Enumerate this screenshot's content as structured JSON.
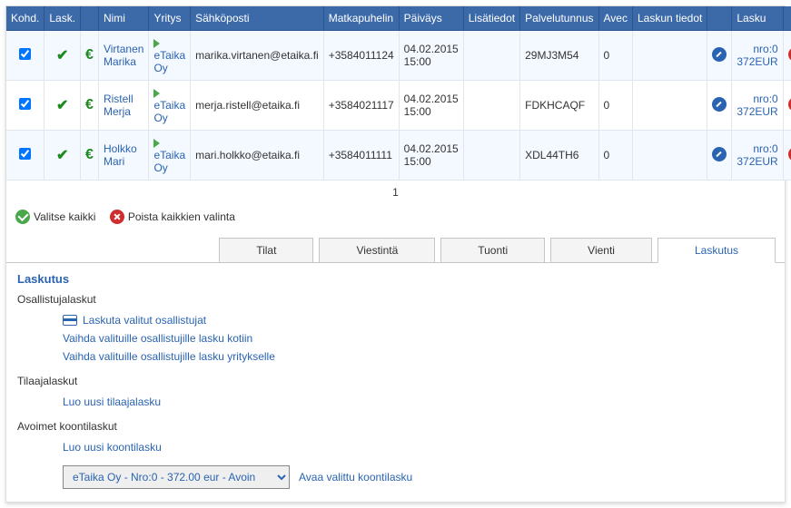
{
  "headers": {
    "kohd": "Kohd.",
    "lask": "Lask.",
    "nimi": "Nimi",
    "yritys": "Yritys",
    "sahkoposti": "Sähköposti",
    "matkapuhelin": "Matkapuhelin",
    "paivays": "Päiväys",
    "lisatiedot": "Lisätiedot",
    "palvelutunnus": "Palvelutunnus",
    "avec": "Avec",
    "laskun_tiedot": "Laskun tiedot",
    "lasku": "Lasku"
  },
  "rows": [
    {
      "nimi": "Virtanen Marika",
      "yritys": "eTaika Oy",
      "sahkoposti": "marika.virtanen@etaika.fi",
      "matkapuhelin": "+3584011124",
      "paivays": "04.02.2015 15:00",
      "lisatiedot": "",
      "palvelutunnus": "29MJ3M54",
      "avec": "0",
      "laskun_tiedot": "",
      "lasku_nro": "nro:0",
      "lasku_sum": "372EUR"
    },
    {
      "nimi": "Ristell Merja",
      "yritys": "eTaika Oy",
      "sahkoposti": "merja.ristell@etaika.fi",
      "matkapuhelin": "+3584021117",
      "paivays": "04.02.2015 15:00",
      "lisatiedot": "",
      "palvelutunnus": "FDKHCAQF",
      "avec": "0",
      "laskun_tiedot": "",
      "lasku_nro": "nro:0",
      "lasku_sum": "372EUR"
    },
    {
      "nimi": "Holkko Mari",
      "yritys": "eTaika Oy",
      "sahkoposti": "mari.holkko@etaika.fi",
      "matkapuhelin": "+3584011111",
      "paivays": "04.02.2015 15:00",
      "lisatiedot": "",
      "palvelutunnus": "XDL44TH6",
      "avec": "0",
      "laskun_tiedot": "",
      "lasku_nro": "nro:0",
      "lasku_sum": "372EUR"
    }
  ],
  "pager": {
    "page": "1"
  },
  "selection": {
    "select_all": "Valitse kaikki",
    "deselect_all": "Poista kaikkien valinta"
  },
  "tabs": {
    "tilat": "Tilat",
    "viestinta": "Viestintä",
    "tuonti": "Tuonti",
    "vienti": "Vienti",
    "laskutus": "Laskutus"
  },
  "invoicing": {
    "title": "Laskutus",
    "osallistujalaskut": "Osallistujalaskut",
    "laskuta_valitut": "Laskuta valitut osallistujat",
    "vaihda_kotiin": "Vaihda valituille osallistujille lasku kotiin",
    "vaihda_yritykselle": "Vaihda valituille osallistujille lasku yritykselle",
    "tilaajalaskut": "Tilaajalaskut",
    "luo_tilaajalasku": "Luo uusi tilaajalasku",
    "avoimet_koontilaskut": "Avoimet koontilaskut",
    "luo_koontilasku": "Luo uusi koontilasku",
    "avaa_koontilasku": "Avaa valittu koontilasku",
    "koonti_options": [
      "eTaika Oy - Nro:0 - 372.00 eur - Avoin"
    ],
    "koonti_selected": "eTaika Oy - Nro:0 - 372.00 eur - Avoin"
  }
}
